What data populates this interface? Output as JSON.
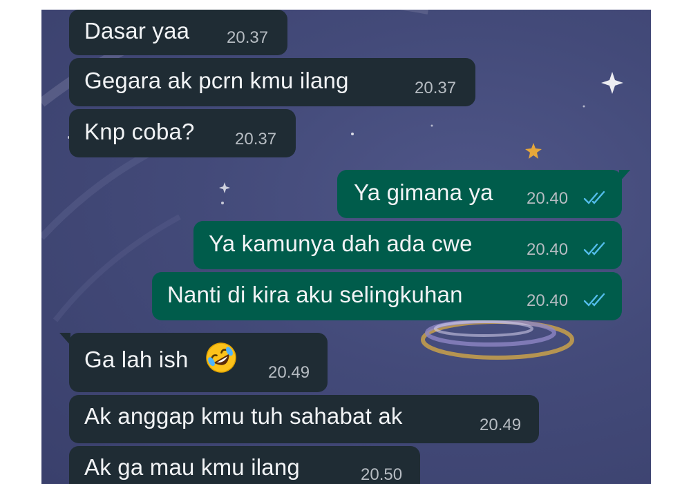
{
  "chat": {
    "accent_incoming": "#1f2c34",
    "accent_outgoing": "#005c4b",
    "tick_color": "#53bdeb",
    "messages": [
      {
        "direction": "incoming",
        "text": "Dasar yaa",
        "time": "20.37"
      },
      {
        "direction": "incoming",
        "text": "Gegara ak pcrn kmu ilang",
        "time": "20.37"
      },
      {
        "direction": "incoming",
        "text": "Knp coba?",
        "time": "20.37"
      },
      {
        "direction": "outgoing",
        "text": "Ya gimana ya",
        "time": "20.40",
        "status": "read"
      },
      {
        "direction": "outgoing",
        "text": "Ya kamunya dah ada cwe",
        "time": "20.40",
        "status": "read"
      },
      {
        "direction": "outgoing",
        "text": "Nanti di kira aku selingkuhan",
        "time": "20.40",
        "status": "read"
      },
      {
        "direction": "incoming",
        "text": "Ga lah ish",
        "emoji": "rolling-on-the-floor-laughing",
        "time": "20.49"
      },
      {
        "direction": "incoming",
        "text": "Ak anggap kmu tuh sahabat ak",
        "time": "20.49"
      },
      {
        "direction": "incoming",
        "text": "Ak ga mau kmu ilang",
        "time": "20.50"
      }
    ]
  }
}
